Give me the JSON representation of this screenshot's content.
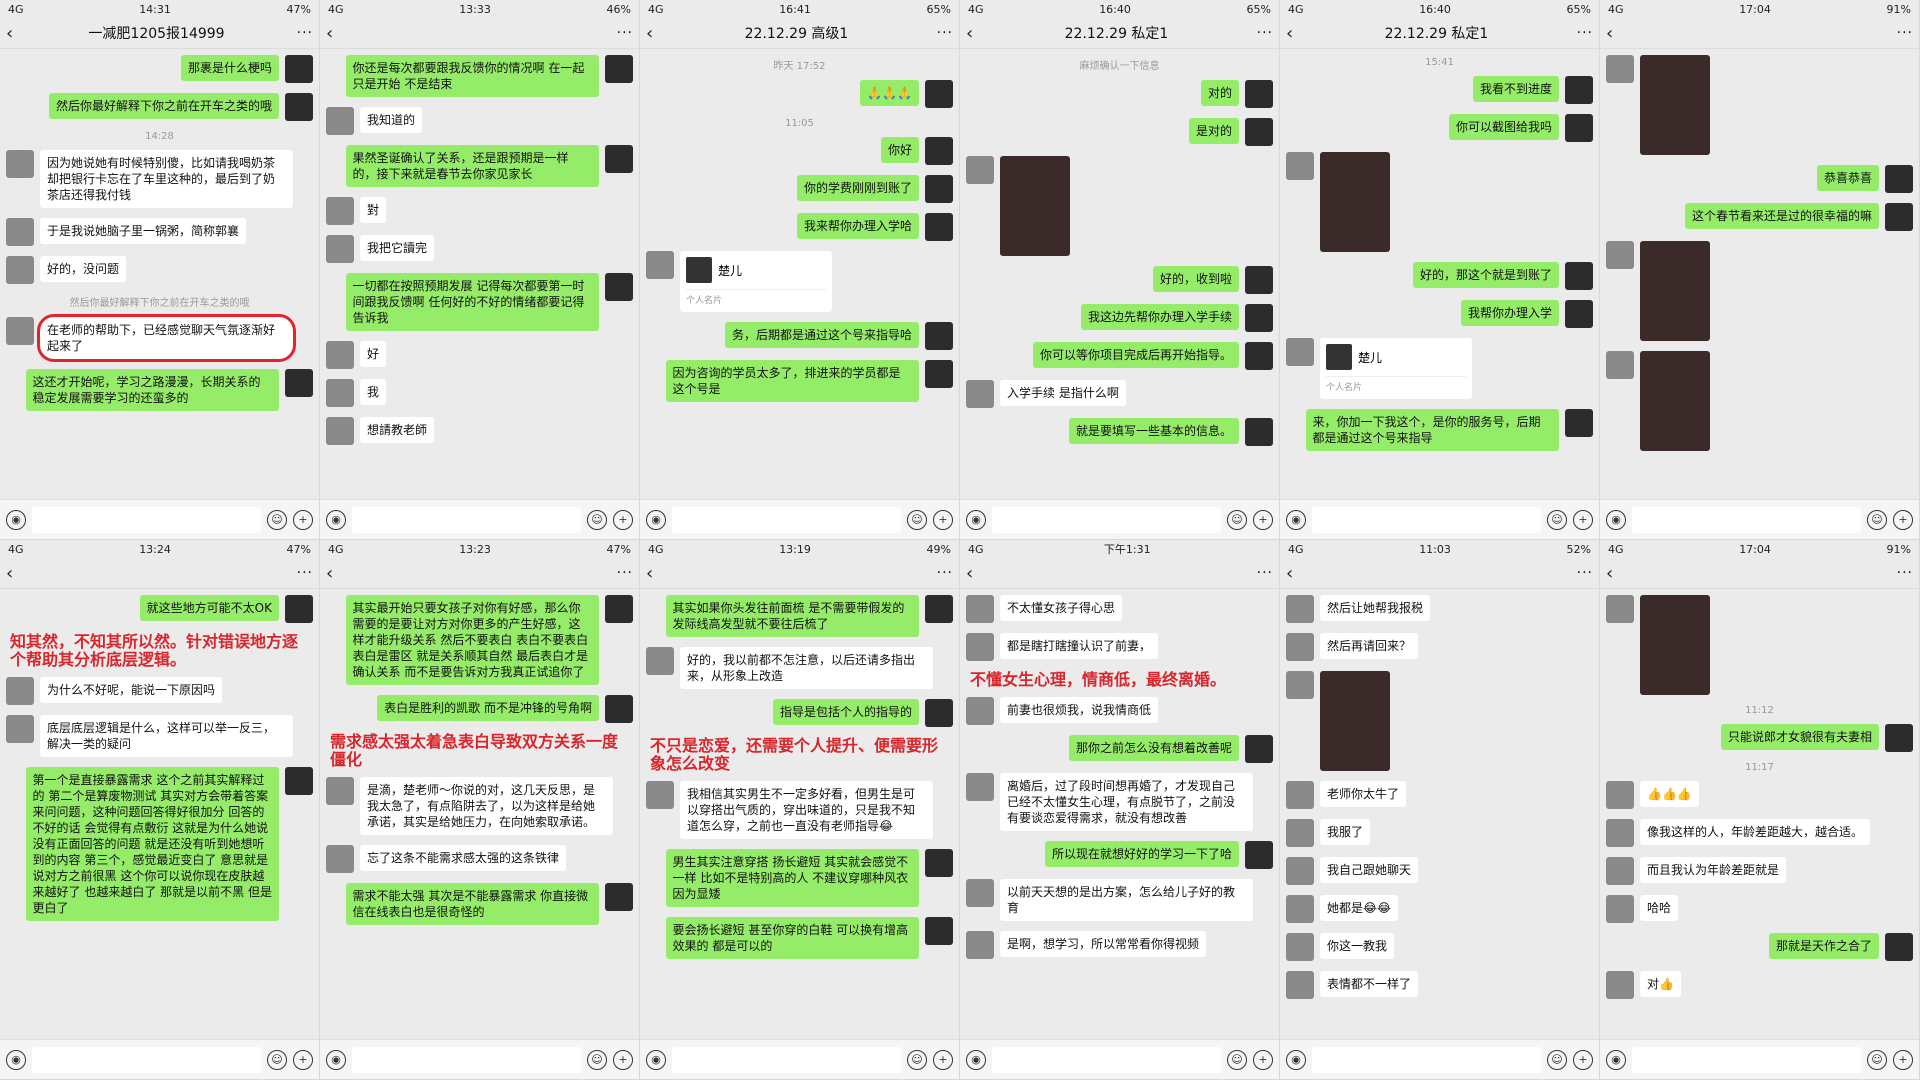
{
  "panels": [
    {
      "status": {
        "left": "4G",
        "time": "14:31",
        "right": "47%"
      },
      "title": "一减肥1205报14999",
      "messages": [
        {
          "side": "me",
          "text": "那裹是什么梗吗"
        },
        {
          "side": "me",
          "text": "然后你最好解释下你之前在开车之类的哦"
        },
        {
          "side": "ts",
          "text": "14:28"
        },
        {
          "side": "them",
          "text": "因为她说她有时候特别傻，比如请我喝奶茶却把银行卡忘在了车里这种的，最后到了奶茶店还得我付钱"
        },
        {
          "side": "them",
          "text": "于是我说她脑子里一锅粥，简称郭襄"
        },
        {
          "side": "them",
          "text": "好的，没问题"
        },
        {
          "side": "ts",
          "text": "然后你最好解释下你之前在开车之类的哦"
        },
        {
          "side": "them",
          "text": "在老师的帮助下，已经感觉聊天气氛逐渐好起来了",
          "circled": true
        },
        {
          "side": "me",
          "text": "这还才开始呢，学习之路漫漫，长期关系的稳定发展需要学习的还蛮多的"
        }
      ]
    },
    {
      "status": {
        "left": "4G",
        "time": "13:33",
        "right": "46%"
      },
      "title": "",
      "messages": [
        {
          "side": "me",
          "text": "你还是每次都要跟我反馈你的情况啊 在一起只是开始 不是结束"
        },
        {
          "side": "them",
          "text": "我知道的"
        },
        {
          "side": "me",
          "text": "果然圣诞确认了关系，还是跟预期是一样的，接下来就是春节去你家见家长"
        },
        {
          "side": "them",
          "text": "對"
        },
        {
          "side": "them",
          "text": "我把它讀完"
        },
        {
          "side": "me",
          "text": "一切都在按照预期发展 记得每次都要第一时间跟我反馈啊 任何好的不好的情绪都要记得告诉我"
        },
        {
          "side": "them",
          "text": "好"
        },
        {
          "side": "them",
          "text": "我"
        },
        {
          "side": "them",
          "text": "想請教老師"
        }
      ]
    },
    {
      "status": {
        "left": "4G",
        "time": "16:41",
        "right": "65%"
      },
      "title": "22.12.29 高级1",
      "messages": [
        {
          "side": "ts",
          "text": "昨天 17:52"
        },
        {
          "side": "me",
          "text": "🙏🙏🙏"
        },
        {
          "side": "ts",
          "text": "11:05"
        },
        {
          "side": "me",
          "text": "你好"
        },
        {
          "side": "me",
          "text": "你的学费刚刚到账了"
        },
        {
          "side": "me",
          "text": "我来帮你办理入学哈"
        },
        {
          "side": "card",
          "text": "楚儿",
          "sub": "个人名片"
        },
        {
          "side": "me",
          "text": "务，后期都是通过这个号来指导哈"
        },
        {
          "side": "me",
          "text": "因为咨询的学员太多了，排进来的学员都是这个号是"
        }
      ]
    },
    {
      "status": {
        "left": "4G",
        "time": "16:40",
        "right": "65%"
      },
      "title": "22.12.29 私定1",
      "messages": [
        {
          "side": "ts",
          "text": "麻烦确认一下信息"
        },
        {
          "side": "me",
          "text": "对的"
        },
        {
          "side": "me",
          "text": "是对的"
        },
        {
          "side": "img",
          "text": ""
        },
        {
          "side": "me",
          "text": "好的，收到啦"
        },
        {
          "side": "me",
          "text": "我这边先帮你办理入学手续"
        },
        {
          "side": "me",
          "text": "你可以等你项目完成后再开始指导。"
        },
        {
          "side": "them",
          "text": "入学手续 是指什么啊"
        },
        {
          "side": "me",
          "text": "就是要填写一些基本的信息。"
        }
      ]
    },
    {
      "status": {
        "left": "4G",
        "time": "16:40",
        "right": "65%"
      },
      "title": "22.12.29 私定1",
      "messages": [
        {
          "side": "ts",
          "text": "15:41"
        },
        {
          "side": "me",
          "text": "我看不到进度"
        },
        {
          "side": "me",
          "text": "你可以截图给我吗"
        },
        {
          "side": "img",
          "text": ""
        },
        {
          "side": "me",
          "text": "好的，那这个就是到账了"
        },
        {
          "side": "me",
          "text": "我帮你办理入学"
        },
        {
          "side": "card",
          "text": "楚儿",
          "sub": "个人名片"
        },
        {
          "side": "me",
          "text": "来，你加一下我这个，是你的服务号，后期都是通过这个号来指导"
        }
      ]
    },
    {
      "status": {
        "left": "4G",
        "time": "17:04",
        "right": "91%"
      },
      "title": "",
      "messages": [
        {
          "side": "img",
          "text": ""
        },
        {
          "side": "me",
          "text": "恭喜恭喜"
        },
        {
          "side": "me",
          "text": "这个春节看来还是过的很幸福的嘛"
        },
        {
          "side": "img",
          "text": ""
        },
        {
          "side": "img",
          "text": ""
        }
      ]
    },
    {
      "status": {
        "left": "4G",
        "time": "13:24",
        "right": "47%"
      },
      "title": "",
      "messages": [
        {
          "side": "me",
          "text": "就这些地方可能不太OK"
        },
        {
          "side": "note",
          "text": "知其然，不知其所以然。针对错误地方逐个帮助其分析底层逻辑。"
        },
        {
          "side": "them",
          "text": "为什么不好呢，能说一下原因吗"
        },
        {
          "side": "them",
          "text": "底层底层逻辑是什么，这样可以举一反三，解决一类的疑问"
        },
        {
          "side": "me",
          "text": "第一个是直接暴露需求 这个之前其实解释过的 第二个是算废物测试 其实对方会带着答案来问问题，这种问题回答得好很加分 回答的不好的话 会觉得有点敷衍 这就是为什么她说没有正面回答的问题 就是还没有听到她想听到的内容 第三个，感觉最近变白了 意思就是说对方之前很黑 这个你可以说你现在皮肤越来越好了 也越来越白了 那就是以前不黑 但是更白了"
        }
      ]
    },
    {
      "status": {
        "left": "4G",
        "time": "13:23",
        "right": "47%"
      },
      "title": "",
      "messages": [
        {
          "side": "me",
          "text": "其实最开始只要女孩子对你有好感，那么你需要的是要让对方对你更多的产生好感，这样才能升级关系 然后不要表白 表白不要表白 表白是雷区 就是关系顺其自然 最后表白才是确认关系 而不是要告诉对方我真正试追你了"
        },
        {
          "side": "me",
          "text": "表白是胜利的凯歌 而不是冲锋的号角啊"
        },
        {
          "side": "note",
          "text": "需求感太强太着急表白导致双方关系一度僵化"
        },
        {
          "side": "them",
          "text": "是滴，楚老师～你说的对，这几天反思，是我太急了，有点陷阱去了，以为这样是给她承诺，其实是给她压力，在向她索取承诺。"
        },
        {
          "side": "them",
          "text": "忘了这条不能需求感太强的这条铁律"
        },
        {
          "side": "me",
          "text": "需求不能太强 其次是不能暴露需求 你直接微信在线表白也是很奇怪的"
        }
      ]
    },
    {
      "status": {
        "left": "4G",
        "time": "13:19",
        "right": "49%"
      },
      "title": "",
      "messages": [
        {
          "side": "me",
          "text": "其实如果你头发往前面梳 是不需要带假发的 发际线高发型就不要往后梳了"
        },
        {
          "side": "them",
          "text": "好的，我以前都不怎注意，以后还请多指出来，从形象上改造"
        },
        {
          "side": "me",
          "text": "指导是包括个人的指导的"
        },
        {
          "side": "note",
          "text": "不只是恋爱，还需要个人提升、便需要形象怎么改变"
        },
        {
          "side": "them",
          "text": "我相信其实男生不一定多好看，但男生是可以穿搭出气质的，穿出味道的，只是我不知道怎么穿，之前也一直没有老师指导😂"
        },
        {
          "side": "me",
          "text": "男生其实注意穿搭 扬长避短 其实就会感觉不一样 比如不是特别高的人 不建议穿哪种风衣 因为显矮"
        },
        {
          "side": "me",
          "text": "要会扬长避短 甚至你穿的白鞋 可以换有增高效果的 都是可以的"
        }
      ]
    },
    {
      "status": {
        "left": "4G",
        "time": "下午1:31",
        "right": ""
      },
      "title": "",
      "messages": [
        {
          "side": "them",
          "text": "不太懂女孩子得心思"
        },
        {
          "side": "them",
          "text": "都是瞎打瞎撞认识了前妻，"
        },
        {
          "side": "note",
          "text": "不懂女生心理，情商低，最终离婚。"
        },
        {
          "side": "them",
          "text": "前妻也很烦我，说我情商低"
        },
        {
          "side": "me",
          "text": "那你之前怎么没有想着改善呢"
        },
        {
          "side": "them",
          "text": "离婚后，过了段时间想再婚了，才发现自己已经不太懂女生心理，有点脱节了，之前没有要谈恋爱得需求，就没有想改善"
        },
        {
          "side": "me",
          "text": "所以现在就想好好的学习一下了哈"
        },
        {
          "side": "them",
          "text": "以前天天想的是出方案，怎么给儿子好的教育"
        },
        {
          "side": "them",
          "text": "是啊，想学习，所以常常看你得视频"
        }
      ]
    },
    {
      "status": {
        "left": "4G",
        "time": "11:03",
        "right": "52%"
      },
      "title": "",
      "messages": [
        {
          "side": "them",
          "text": "然后让她帮我报税"
        },
        {
          "side": "them",
          "text": "然后再请回来？"
        },
        {
          "side": "img",
          "text": ""
        },
        {
          "side": "them",
          "text": "老师你太牛了"
        },
        {
          "side": "them",
          "text": "我服了"
        },
        {
          "side": "them",
          "text": "我自己跟她聊天"
        },
        {
          "side": "them",
          "text": "她都是😂😂"
        },
        {
          "side": "them",
          "text": "你这一教我"
        },
        {
          "side": "them",
          "text": "表情都不一样了"
        }
      ]
    },
    {
      "status": {
        "left": "4G",
        "time": "17:04",
        "right": "91%"
      },
      "title": "",
      "messages": [
        {
          "side": "img",
          "text": ""
        },
        {
          "side": "ts",
          "text": "11:12"
        },
        {
          "side": "me",
          "text": "只能说郎才女貌很有夫妻相"
        },
        {
          "side": "ts",
          "text": "11:17"
        },
        {
          "side": "them",
          "text": "👍👍👍"
        },
        {
          "side": "them",
          "text": "像我这样的人，年龄差距越大，越合适。"
        },
        {
          "side": "them",
          "text": "而且我认为年龄差距就是"
        },
        {
          "side": "them",
          "text": "哈哈"
        },
        {
          "side": "me",
          "text": "那就是天作之合了"
        },
        {
          "side": "them",
          "text": "对👍"
        }
      ]
    }
  ],
  "footer": {
    "voice_icon": "voice-icon",
    "emoji_icon": "emoji-icon",
    "plus_icon": "plus-icon"
  }
}
